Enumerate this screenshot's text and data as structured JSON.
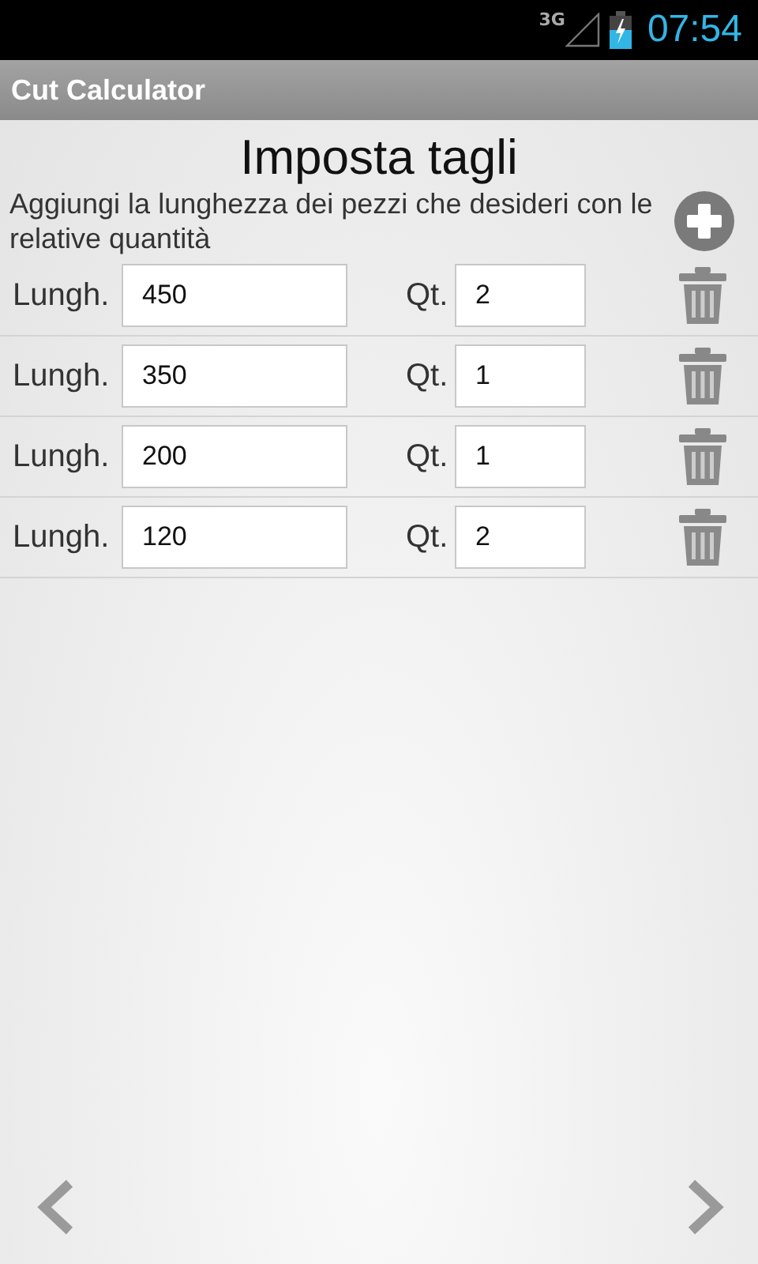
{
  "status_bar": {
    "network": "3G",
    "time": "07:54"
  },
  "action_bar": {
    "title": "Cut Calculator"
  },
  "heading": "Imposta tagli",
  "instructions": "Aggiungi la lunghezza dei pezzi che desideri con le relative quantità",
  "rows": [
    {
      "length_label": "Lungh.",
      "length": "450",
      "qty_label": "Qt.",
      "qty": "2"
    },
    {
      "length_label": "Lungh.",
      "length": "350",
      "qty_label": "Qt.",
      "qty": "1"
    },
    {
      "length_label": "Lungh.",
      "length": "200",
      "qty_label": "Qt.",
      "qty": "1"
    },
    {
      "length_label": "Lungh.",
      "length": "120",
      "qty_label": "Qt.",
      "qty": "2"
    }
  ]
}
